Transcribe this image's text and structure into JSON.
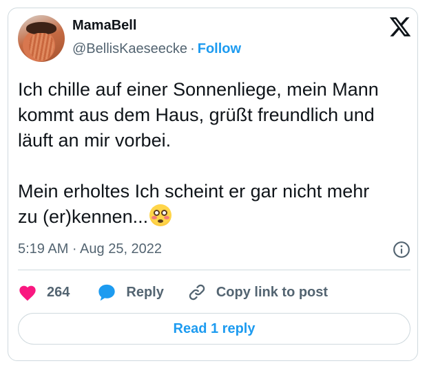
{
  "author": {
    "display_name": "MamaBell",
    "handle": "@BellisKaeseecke",
    "separator": "·",
    "follow_label": "Follow"
  },
  "tweet": {
    "paragraphs": [
      "Ich chille auf einer Sonnenliege, mein Mann kommt aus dem Haus, grüßt freundlich und läuft an mir vorbei.",
      "Mein erholtes Ich scheint er gar nicht mehr zu (er)kennen..."
    ],
    "emoji": "flushed-face-emoji",
    "timestamp": "5:19 AM · Aug 25, 2022"
  },
  "actions": {
    "like_count": "264",
    "reply_label": "Reply",
    "copy_link_label": "Copy link to post"
  },
  "read_replies_label": "Read 1 reply",
  "icons": {
    "platform_logo": "x-logo-icon",
    "info": "info-icon",
    "like": "heart-icon",
    "reply": "speech-bubble-icon",
    "copy_link": "link-icon"
  },
  "colors": {
    "accent": "#1d9bf0",
    "like": "#f91880",
    "text": "#0f1419",
    "secondary_text": "#536471",
    "border": "#cfd9de"
  }
}
